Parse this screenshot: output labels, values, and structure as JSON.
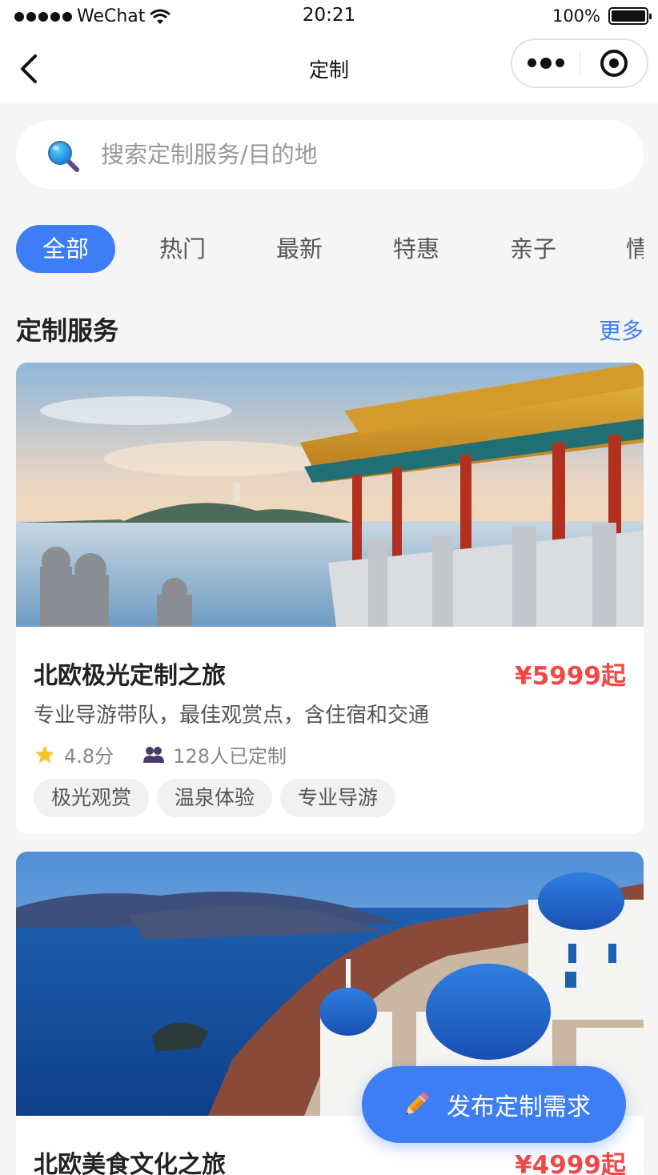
{
  "status_bar": {
    "carrier": "WeChat",
    "time": "20:21",
    "battery": "100%",
    "battery_level": 1.0
  },
  "nav": {
    "title": "定制"
  },
  "search": {
    "placeholder": "搜索定制服务/目的地"
  },
  "tabs": [
    {
      "label": "全部",
      "active": true
    },
    {
      "label": "热门",
      "active": false
    },
    {
      "label": "最新",
      "active": false
    },
    {
      "label": "特惠",
      "active": false
    },
    {
      "label": "亲子",
      "active": false
    },
    {
      "label": "情",
      "active": false
    }
  ],
  "section": {
    "title": "定制服务",
    "more": "更多"
  },
  "cards": [
    {
      "title": "北欧极光定制之旅",
      "price": "¥5999起",
      "desc": "专业导游带队，最佳观赏点，含住宿和交通",
      "rating": "4.8分",
      "customized": "128人已定制",
      "tags": [
        "极光观赏",
        "温泉体验",
        "专业导游"
      ]
    },
    {
      "title": "北欧美食文化之旅",
      "price": "¥4999起"
    }
  ],
  "fab": {
    "label": "发布定制需求"
  },
  "colors": {
    "accent": "#3d7ef6",
    "price": "#f04848",
    "star": "#f7c52b"
  },
  "icons": [
    "back-arrow-icon",
    "more-dots-icon",
    "close-circle-icon",
    "search-icon",
    "star-icon",
    "people-icon",
    "pencil-icon"
  ]
}
